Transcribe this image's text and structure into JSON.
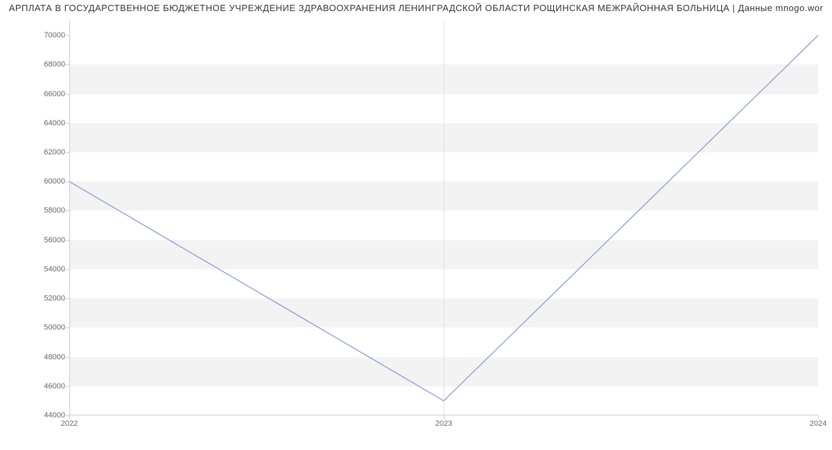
{
  "chart_data": {
    "type": "line",
    "title": "АРПЛАТА В ГОСУДАРСТВЕННОЕ БЮДЖЕТНОЕ УЧРЕЖДЕНИЕ ЗДРАВООХРАНЕНИЯ ЛЕНИНГРАДСКОЙ ОБЛАСТИ РОЩИНСКАЯ МЕЖРАЙОННАЯ БОЛЬНИЦА | Данные mnogo.wor",
    "x": [
      2022,
      2023,
      2024
    ],
    "values": [
      60000,
      45000,
      70000
    ],
    "x_ticks": [
      2022,
      2023,
      2024
    ],
    "y_ticks": [
      44000,
      46000,
      48000,
      50000,
      52000,
      54000,
      56000,
      58000,
      60000,
      62000,
      64000,
      66000,
      68000,
      70000
    ],
    "ylim": [
      44000,
      71000
    ],
    "xlabel": "",
    "ylabel": "",
    "line_color": "#7b95dc"
  }
}
